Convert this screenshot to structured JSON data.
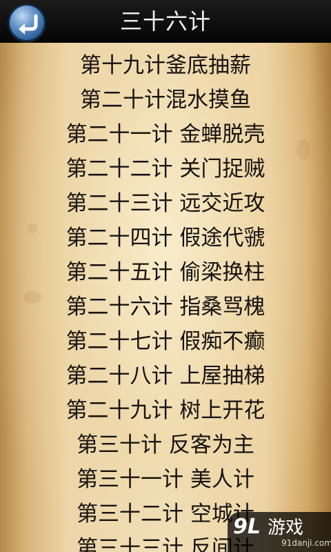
{
  "header": {
    "title": "三十六计",
    "back_icon": "back-arrow-icon"
  },
  "stratagems": [
    "第十九计釜底抽薪",
    "第二十计混水摸鱼",
    "第二十一计 金蝉脱壳",
    "第二十二计 关门捉贼",
    "第二十三计 远交近攻",
    "第二十四计 假途代虢",
    "第二十五计 偷梁换柱",
    "第二十六计 指桑骂槐",
    "第二十七计 假痴不癫",
    "第二十八计 上屋抽梯",
    "第二十九计 树上开花",
    "第三十计 反客为主",
    "第三十一计 美人计",
    "第三十二计 空城计",
    "第三十三计 反间计"
  ],
  "watermark": {
    "logo": "9L",
    "name": "游戏",
    "url": "91danji.com"
  }
}
